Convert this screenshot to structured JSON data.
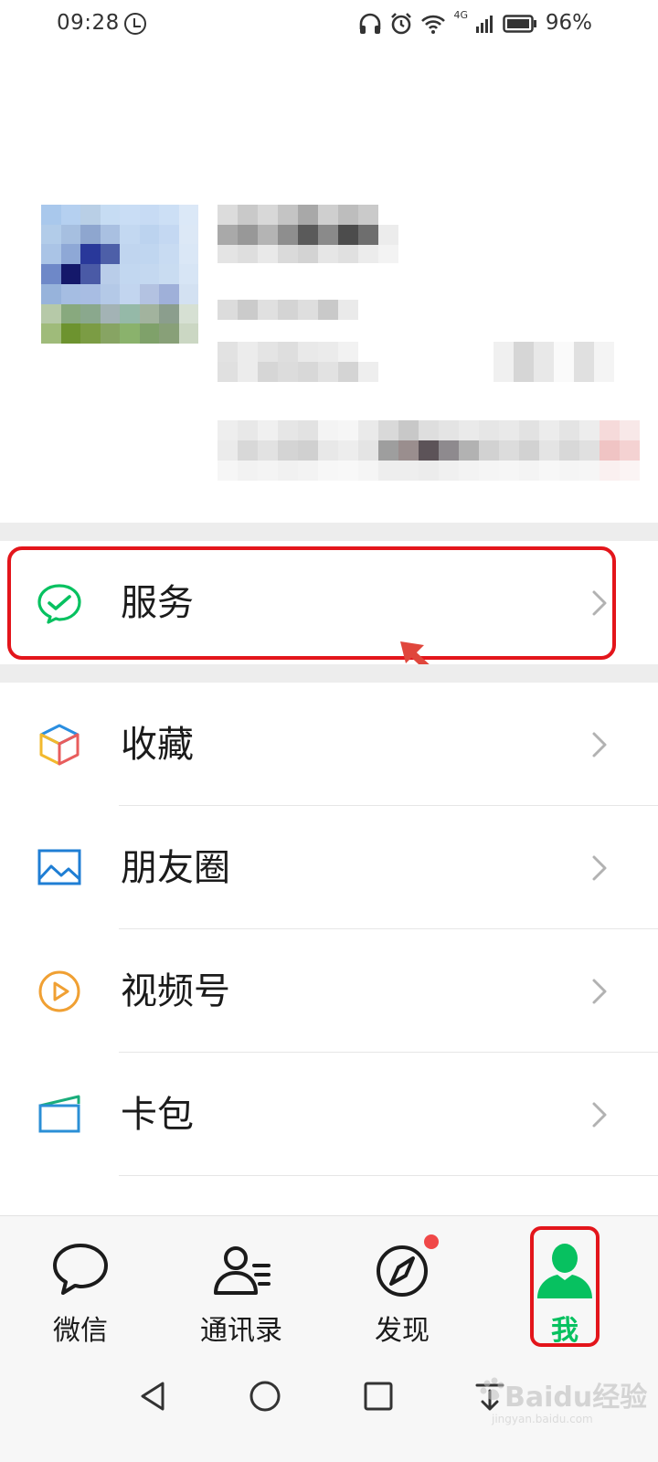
{
  "status_bar": {
    "time": "09:28",
    "network_label": "4G",
    "battery_percent": "96%",
    "icons": [
      "clock-icon",
      "headphones-icon",
      "alarm-icon",
      "wifi-icon",
      "signal-icon",
      "battery-icon"
    ]
  },
  "menu": {
    "items": [
      {
        "label": "服务",
        "icon": "wechat-pay-icon",
        "color": "#07c160"
      },
      {
        "label": "收藏",
        "icon": "cube-icon",
        "color": "#f0b429"
      },
      {
        "label": "朋友圈",
        "icon": "image-icon",
        "color": "#1f7ed4"
      },
      {
        "label": "视频号",
        "icon": "play-icon",
        "color": "#f0a033"
      },
      {
        "label": "卡包",
        "icon": "card-icon",
        "color": "#2b8fd6"
      }
    ]
  },
  "tab_bar": {
    "tabs": [
      {
        "label": "微信",
        "icon": "chat-icon"
      },
      {
        "label": "通讯录",
        "icon": "contacts-icon"
      },
      {
        "label": "发现",
        "icon": "compass-icon",
        "badge": true
      },
      {
        "label": "我",
        "icon": "person-icon",
        "active": true
      }
    ],
    "active_color": "#07c160"
  },
  "annotation": {
    "highlight_color": "#e3151b"
  },
  "watermark": {
    "text": "Baidu经验",
    "sub": "jingyan.baidu.com"
  }
}
